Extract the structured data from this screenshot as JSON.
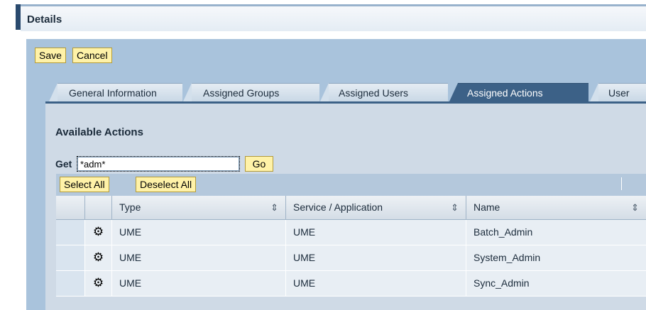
{
  "header": {
    "title": "Details"
  },
  "toolbar": {
    "save_label": "Save",
    "cancel_label": "Cancel"
  },
  "tabs": [
    {
      "label": "General Information"
    },
    {
      "label": "Assigned Groups"
    },
    {
      "label": "Assigned Users"
    },
    {
      "label": "Assigned Actions",
      "active": true
    },
    {
      "label": "User"
    }
  ],
  "section": {
    "title": "Available Actions",
    "get_label": "Get",
    "search_value": "*adm*",
    "go_label": "Go",
    "select_all_label": "Select All",
    "deselect_all_label": "Deselect All"
  },
  "table": {
    "columns": [
      "Type",
      "Service / Application",
      "Name"
    ],
    "rows": [
      {
        "icon": "action-icon",
        "type": "UME",
        "service": "UME",
        "name": "Batch_Admin"
      },
      {
        "icon": "action-icon",
        "type": "UME",
        "service": "UME",
        "name": "System_Admin"
      },
      {
        "icon": "action-icon",
        "type": "UME",
        "service": "UME",
        "name": "Sync_Admin"
      }
    ]
  },
  "colors": {
    "accent": "#3c6187",
    "panel": "#a9c3dc",
    "button": "#fff2a8"
  }
}
